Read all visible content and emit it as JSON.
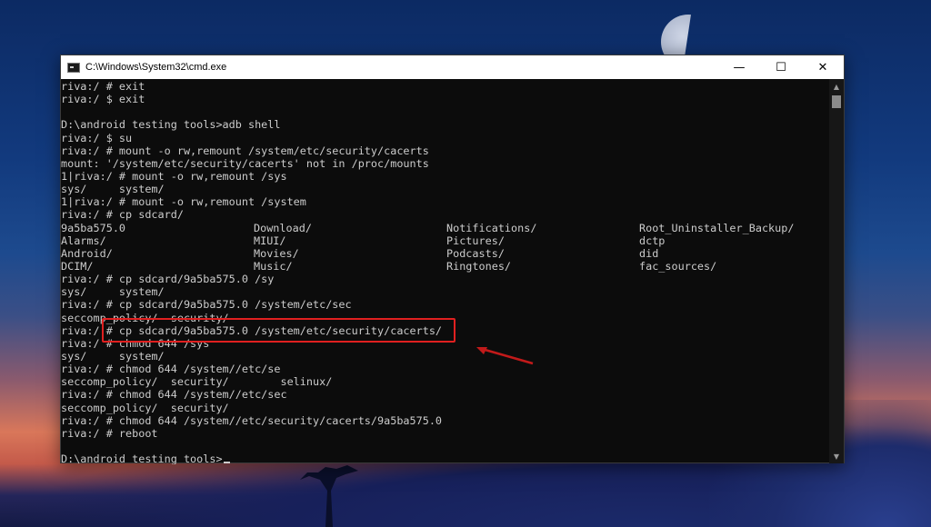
{
  "window": {
    "title": "C:\\Windows\\System32\\cmd.exe",
    "controls": {
      "minimize": "—",
      "maximize": "☐",
      "close": "✕"
    }
  },
  "terminal": {
    "lines": [
      "riva:/ # exit",
      "riva:/ $ exit",
      "",
      "D:\\android testing tools>adb shell",
      "riva:/ $ su",
      "riva:/ # mount -o rw,remount /system/etc/security/cacerts",
      "mount: '/system/etc/security/cacerts' not in /proc/mounts",
      "1|riva:/ # mount -o rw,remount /sys",
      "sys/     system/",
      "1|riva:/ # mount -o rw,remount /system",
      "riva:/ # cp sdcard/"
    ],
    "listing": [
      [
        "9a5ba575.0",
        "Download/",
        "Notifications/",
        "Root_Uninstaller_Backup/"
      ],
      [
        "Alarms/",
        "MIUI/",
        "Pictures/",
        "dctp"
      ],
      [
        "Android/",
        "Movies/",
        "Podcasts/",
        "did"
      ],
      [
        "DCIM/",
        "Music/",
        "Ringtones/",
        "fac_sources/"
      ]
    ],
    "lines_after": [
      "riva:/ # cp sdcard/9a5ba575.0 /sy",
      "sys/     system/",
      "riva:/ # cp sdcard/9a5ba575.0 /system/etc/sec",
      "seccomp_policy/  security/",
      "riva:/ # cp sdcard/9a5ba575.0 /system/etc/security/cacerts/",
      "riva:/ # chmod 644 /sys",
      "sys/     system/",
      "riva:/ # chmod 644 /system//etc/se",
      "seccomp_policy/  security/        selinux/",
      "riva:/ # chmod 644 /system//etc/sec",
      "seccomp_policy/  security/",
      "riva:/ # chmod 644 /system//etc/security/cacerts/9a5ba575.0",
      "riva:/ # reboot",
      "",
      "D:\\android testing tools>"
    ]
  },
  "annotation": {
    "highlight_color": "#e02020"
  },
  "icons": {
    "app": "cmd-icon",
    "scroll_up": "▲",
    "scroll_down": "▼"
  }
}
